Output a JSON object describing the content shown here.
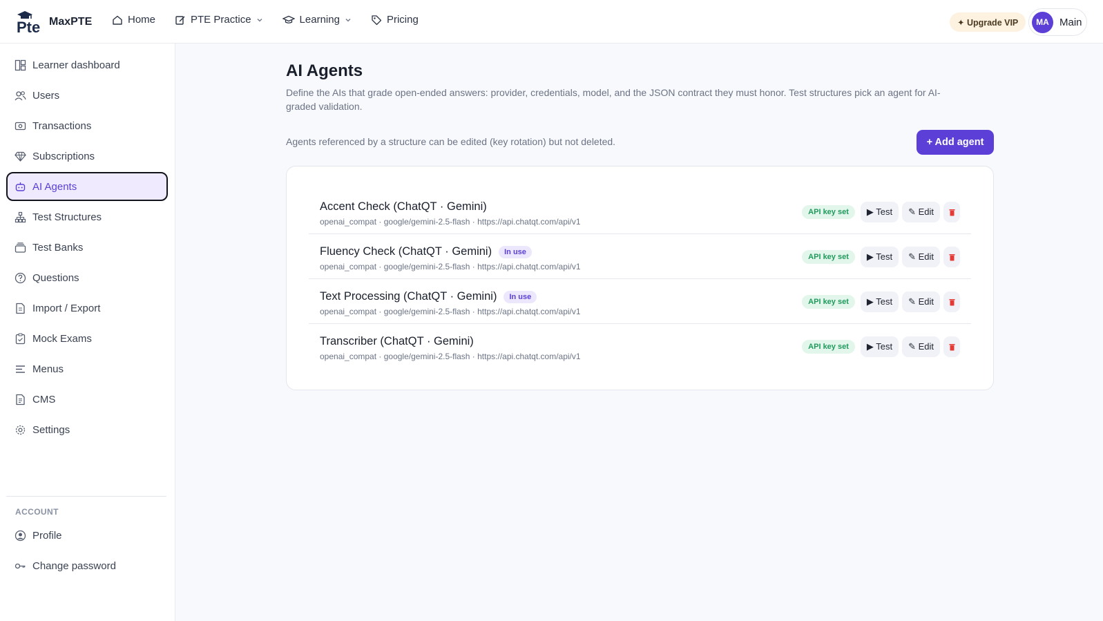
{
  "brand": {
    "name": "MaxPTE",
    "logo_text": "Pte"
  },
  "nav": [
    {
      "label": "Home",
      "icon": "home-icon"
    },
    {
      "label": "PTE Practice",
      "icon": "edit-icon",
      "dropdown": true
    },
    {
      "label": "Learning",
      "icon": "graduation-cap-icon",
      "dropdown": true
    },
    {
      "label": "Pricing",
      "icon": "tag-icon"
    }
  ],
  "header": {
    "upgrade_label": "✦ Upgrade VIP",
    "avatar_initials": "MA",
    "user_name": "Main"
  },
  "sidebar": {
    "items": [
      {
        "label": "Learner dashboard",
        "icon": "dashboard-icon"
      },
      {
        "label": "Users",
        "icon": "users-icon"
      },
      {
        "label": "Transactions",
        "icon": "money-icon"
      },
      {
        "label": "Subscriptions",
        "icon": "diamond-icon"
      },
      {
        "label": "AI Agents",
        "icon": "robot-icon",
        "active": true
      },
      {
        "label": "Test Structures",
        "icon": "hierarchy-icon"
      },
      {
        "label": "Test Banks",
        "icon": "stack-icon"
      },
      {
        "label": "Questions",
        "icon": "question-icon"
      },
      {
        "label": "Import / Export",
        "icon": "file-transfer-icon"
      },
      {
        "label": "Mock Exams",
        "icon": "clipboard-icon"
      },
      {
        "label": "Menus",
        "icon": "menu-icon"
      },
      {
        "label": "CMS",
        "icon": "document-icon"
      },
      {
        "label": "Settings",
        "icon": "gear-icon"
      }
    ],
    "account_heading": "ACCOUNT",
    "account_items": [
      {
        "label": "Profile",
        "icon": "user-circle-icon"
      },
      {
        "label": "Change password",
        "icon": "key-icon"
      }
    ]
  },
  "main": {
    "title": "AI Agents",
    "description": "Define the AIs that grade open-ended answers: provider, credentials, model, and the JSON contract they must honor. Test structures pick an agent for AI-graded validation.",
    "note": "Agents referenced by a structure can be edited (key rotation) but not deleted.",
    "add_label": "+ Add agent"
  },
  "agents": [
    {
      "name": "Accent Check (ChatQT · Gemini)",
      "in_use": "",
      "meta": "openai_compat · google/gemini-2.5-flash · https://api.chatqt.com/api/v1",
      "api_badge": "API key set",
      "test_label": "▶ Test",
      "edit_label": "✎ Edit"
    },
    {
      "name": "Fluency Check (ChatQT · Gemini)",
      "in_use": "In use",
      "meta": "openai_compat · google/gemini-2.5-flash · https://api.chatqt.com/api/v1",
      "api_badge": "API key set",
      "test_label": "▶ Test",
      "edit_label": "✎ Edit"
    },
    {
      "name": "Text Processing (ChatQT · Gemini)",
      "in_use": "In use",
      "meta": "openai_compat · google/gemini-2.5-flash · https://api.chatqt.com/api/v1",
      "api_badge": "API key set",
      "test_label": "▶ Test",
      "edit_label": "✎ Edit"
    },
    {
      "name": "Transcriber (ChatQT · Gemini)",
      "in_use": "",
      "meta": "openai_compat · google/gemini-2.5-flash · https://api.chatqt.com/api/v1",
      "api_badge": "API key set",
      "test_label": "▶ Test",
      "edit_label": "✎ Edit"
    }
  ],
  "colors": {
    "accent": "#5b3fd6",
    "api_green": "#1f9a5b",
    "danger": "#e53935"
  }
}
